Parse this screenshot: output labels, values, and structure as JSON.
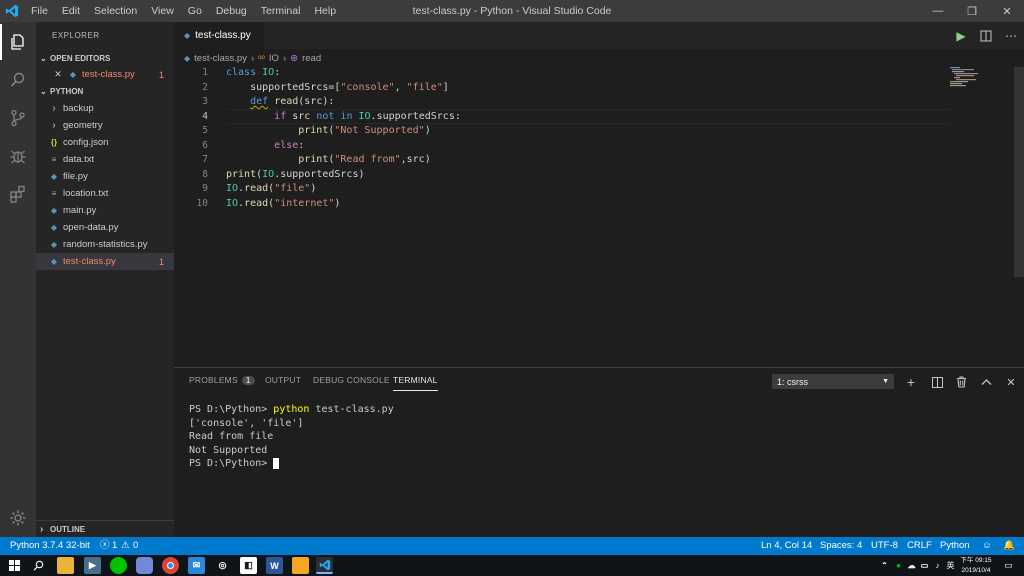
{
  "titlebar": {
    "menus": [
      "File",
      "Edit",
      "Selection",
      "View",
      "Go",
      "Debug",
      "Terminal",
      "Help"
    ],
    "title": "test-class.py - Python - Visual Studio Code",
    "minimize": "—",
    "restore": "❐",
    "close": "✕"
  },
  "sidebar": {
    "title": "EXPLORER",
    "open_editors": {
      "label": "OPEN EDITORS",
      "items": [
        {
          "name": "test-class.py",
          "badge": "1"
        }
      ]
    },
    "folder": {
      "label": "PYTHON",
      "items": [
        {
          "name": "backup",
          "kind": "folder"
        },
        {
          "name": "geometry",
          "kind": "folder"
        },
        {
          "name": "config.json",
          "kind": "json"
        },
        {
          "name": "data.txt",
          "kind": "txt"
        },
        {
          "name": "file.py",
          "kind": "py"
        },
        {
          "name": "location.txt",
          "kind": "txt"
        },
        {
          "name": "main.py",
          "kind": "py"
        },
        {
          "name": "open-data.py",
          "kind": "py"
        },
        {
          "name": "random-statistics.py",
          "kind": "py"
        },
        {
          "name": "test-class.py",
          "kind": "py",
          "badge": "1"
        }
      ]
    },
    "outline": "OUTLINE"
  },
  "editor": {
    "tab": "test-class.py",
    "breadcrumb": [
      "test-class.py",
      "IO",
      "read"
    ],
    "line_numbers": [
      "1",
      "2",
      "3",
      "4",
      "5",
      "6",
      "7",
      "8",
      "9",
      "10"
    ],
    "current_line": "4"
  },
  "panel": {
    "tabs": {
      "problems": "PROBLEMS",
      "problems_count": "1",
      "output": "OUTPUT",
      "debug": "DEBUG CONSOLE",
      "terminal": "TERMINAL"
    },
    "terminal_select": "1: csrss",
    "terminal": {
      "prompt1": "PS D:\\Python> ",
      "cmd1": "python",
      "arg1": " test-class.py",
      "out1": "['console', 'file']",
      "out2": "Read from file",
      "out3": "Not Supported",
      "prompt2": "PS D:\\Python> "
    }
  },
  "status": {
    "interpreter": "Python 3.7.4 32-bit",
    "errors": "1",
    "warnings": "0",
    "position": "Ln 4, Col 14",
    "spaces": "Spaces: 4",
    "encoding": "UTF-8",
    "eol": "CRLF",
    "language": "Python"
  },
  "taskbar": {
    "time": "下午 09:15",
    "date": "2019/10/4",
    "ime": "英"
  },
  "colors": {
    "accent": "#007acc",
    "error": "#f48771",
    "terminal_cmd": "#ffff00"
  }
}
